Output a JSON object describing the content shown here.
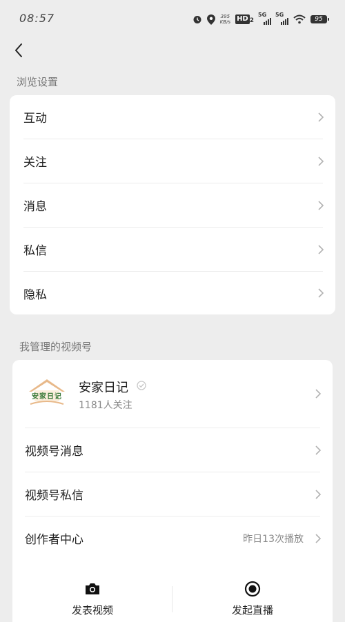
{
  "status_bar": {
    "time": "08:57",
    "net_speed_value": "395",
    "net_speed_unit": "KB/s",
    "hd_label": "HD",
    "hd_sub": "2",
    "signal1_label": "5G",
    "signal2_label": "5G",
    "battery": "95"
  },
  "nav": {
    "back_icon": "chevron-left-icon"
  },
  "browse_settings": {
    "title": "浏览设置",
    "items": [
      {
        "label": "互动"
      },
      {
        "label": "关注"
      },
      {
        "label": "消息"
      },
      {
        "label": "私信"
      },
      {
        "label": "隐私"
      }
    ]
  },
  "channels": {
    "title": "我管理的视频号",
    "account": {
      "name": "安家日记",
      "followers": "1181人关注",
      "avatar_text": "安家日记"
    },
    "items": [
      {
        "label": "视频号消息",
        "note": ""
      },
      {
        "label": "视频号私信",
        "note": ""
      },
      {
        "label": "创作者中心",
        "note": "昨日13次播放"
      }
    ],
    "actions": [
      {
        "label": "发表视频",
        "icon": "camera-icon"
      },
      {
        "label": "发起直播",
        "icon": "live-record-icon"
      }
    ]
  },
  "colors": {
    "background": "#ededed",
    "card": "#ffffff",
    "chevron": "#b3b3b3",
    "avatar_roof": "#e8b98a",
    "avatar_text": "#3a7a3a"
  }
}
